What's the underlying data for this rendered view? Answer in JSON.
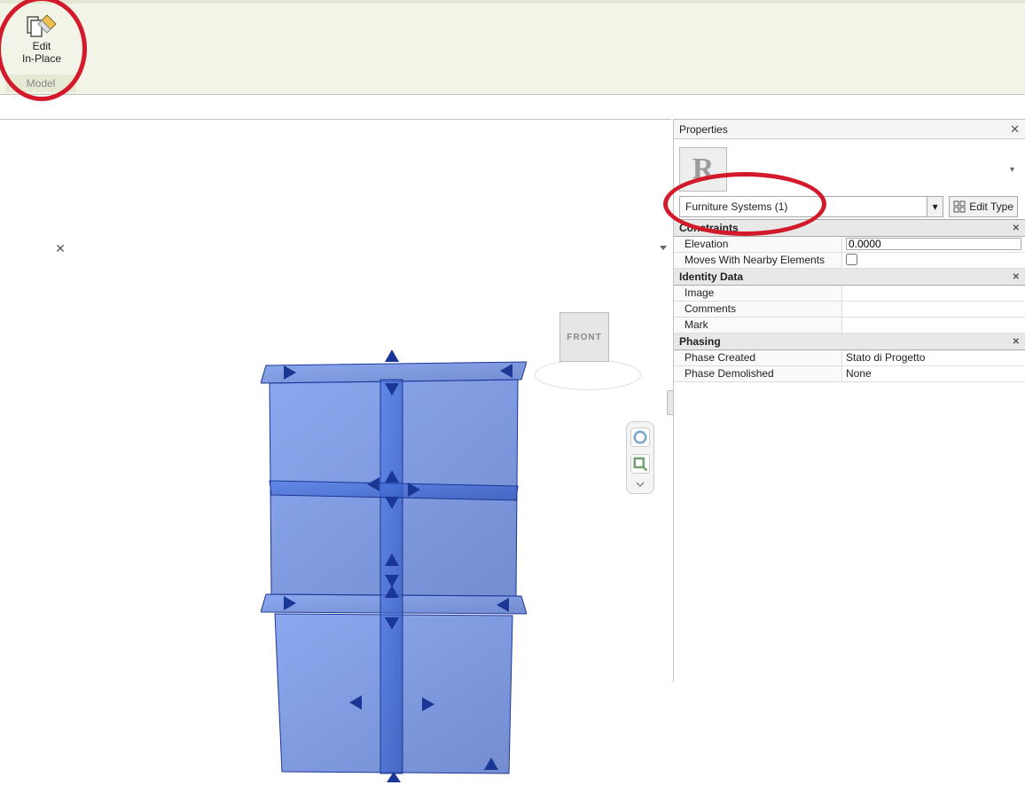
{
  "ribbon": {
    "edit_line1": "Edit",
    "edit_line2": "In-Place",
    "panel_label": "Model"
  },
  "viewcube": {
    "face": "FRONT"
  },
  "properties": {
    "title": "Properties",
    "selector": "Furniture Systems (1)",
    "edit_type_label": "Edit Type",
    "sections": {
      "constraints": {
        "title": "Constraints",
        "elevation_label": "Elevation",
        "elevation_value": "0.0000",
        "moves_label": "Moves With Nearby Elements",
        "moves_value": false
      },
      "identity": {
        "title": "Identity Data",
        "image_label": "Image",
        "image_value": "",
        "comments_label": "Comments",
        "comments_value": "",
        "mark_label": "Mark",
        "mark_value": ""
      },
      "phasing": {
        "title": "Phasing",
        "created_label": "Phase Created",
        "created_value": "Stato di Progetto",
        "demolished_label": "Phase Demolished",
        "demolished_value": "None"
      }
    }
  }
}
